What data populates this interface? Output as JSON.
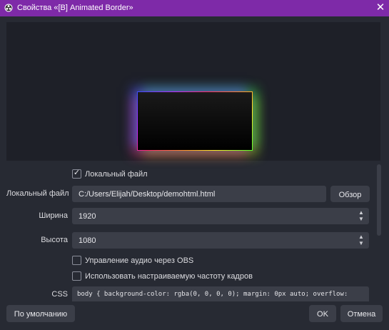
{
  "window": {
    "title": "Свойства «[B] Animated Border»",
    "close_glyph": "✕"
  },
  "form": {
    "local_file_checkbox": {
      "label": "Локальный файл",
      "checked": true,
      "tick": "✓"
    },
    "local_file": {
      "label": "Локальный файл",
      "value": "C:/Users/Elijah/Desktop/demohtml.html",
      "browse_label": "Обзор"
    },
    "width": {
      "label": "Ширина",
      "value": "1920"
    },
    "height": {
      "label": "Высота",
      "value": "1080"
    },
    "audio_checkbox": {
      "label": "Управление аудио через OBS",
      "checked": false
    },
    "framerate_checkbox": {
      "label": "Использовать настраиваемую частоту кадров",
      "checked": false
    },
    "css": {
      "label": "CSS",
      "value": "body { background-color: rgba(0, 0, 0, 0); margin: 0px auto; overflow:"
    }
  },
  "spin": {
    "up": "▲",
    "down": "▼"
  },
  "buttons": {
    "defaults": "По умолчанию",
    "ok": "OK",
    "cancel": "Отмена"
  },
  "colors": {
    "titlebar": "#7e2aa8",
    "window_bg": "#272a33",
    "field_bg": "#3b3e48",
    "preview_bg": "#1e2028"
  },
  "icons": {
    "app": "obs-logo-icon",
    "close": "close-icon",
    "checkbox": "checkmark-icon",
    "spin_up": "chevron-up-icon",
    "spin_down": "chevron-down-icon"
  }
}
